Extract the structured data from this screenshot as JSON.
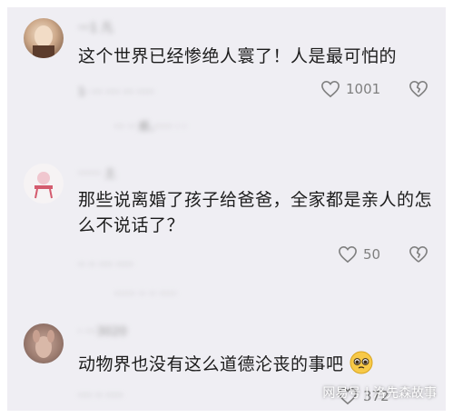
{
  "comments": [
    {
      "text": "这个世界已经惨绝人寰了！人是最可怕的",
      "likes": "1001",
      "username_blurred": "一1 凡",
      "meta_blurred": "1· ··· ···· ··· ·····",
      "reply_blurred": "··· ·· 痕，····· · ·"
    },
    {
      "text": "那些说离婚了孩子给爸爸，全家都是亲人的怎么不说话了？",
      "likes": "50",
      "username_blurred": "······ 土",
      "meta_blurred": "·· ·· ···· ·····",
      "reply_blurred": "······ ·· ·· ·····"
    },
    {
      "text": "动物界也没有这么道德沦丧的事吧",
      "likes": "372",
      "username_blurred": "· ···3020",
      "meta_blurred": "···· ·· ·····",
      "reply_blurred": ""
    }
  ],
  "emoji": "pleading-face",
  "watermark": "网易号 | 洛先森故事",
  "colors": {
    "background": "#efeef3",
    "text": "#1c1c1c",
    "meta": "#8e8e8e"
  }
}
